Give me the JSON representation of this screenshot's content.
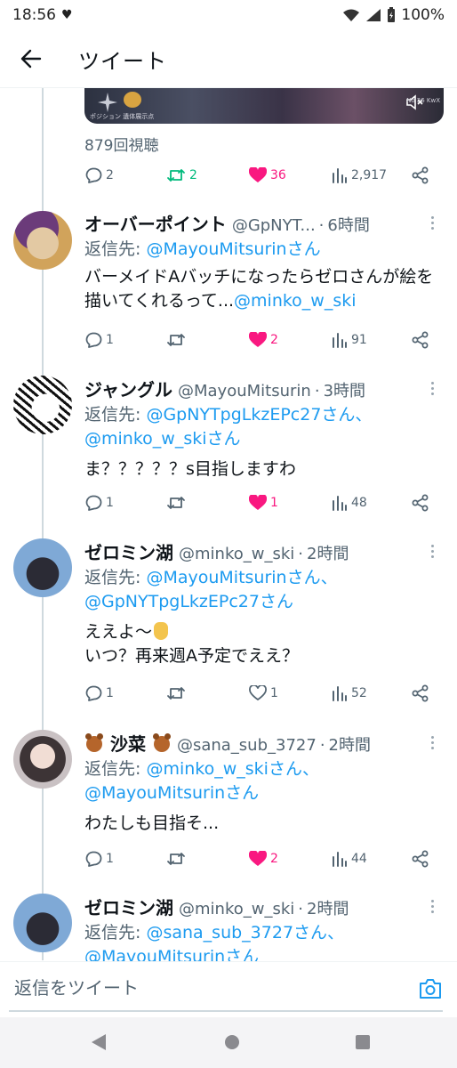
{
  "status_bar": {
    "time": "18:56",
    "battery": "100%"
  },
  "header": {
    "title": "ツイート"
  },
  "first_tweet": {
    "views": "879回視聴",
    "media_caption": "ポジション 遺体展示点",
    "media_number": "No.26 KwX",
    "actions": {
      "replies": "2",
      "retweets": "2",
      "likes": "36",
      "views": "2,917"
    }
  },
  "tweets": [
    {
      "name": "オーバーポイント",
      "handle": "@GpNYT...",
      "time": "6時間",
      "reply_prefix": "返信先: ",
      "reply_to": "@MayouMitsurinさん",
      "reply_to_2": "",
      "body": "バーメイドAバッチになったらゼロさんが絵を描いてくれるって...",
      "body_mention": "@minko_w_ski",
      "actions": {
        "replies": "1",
        "retweets": "",
        "likes": "2",
        "views": "91"
      },
      "liked": true
    },
    {
      "name": "ジャングル",
      "handle": "@MayouMitsurin",
      "time": "3時間",
      "reply_prefix": "返信先: ",
      "reply_to": "@GpNYTpgLkzEPc27さん、",
      "reply_to_2": "@minko_w_skiさん",
      "body": "ま？？？？？s目指しますわ",
      "actions": {
        "replies": "1",
        "retweets": "",
        "likes": "1",
        "views": "48"
      },
      "liked": true
    },
    {
      "name": "ゼロミン湖",
      "handle": "@minko_w_ski",
      "time": "2時間",
      "reply_prefix": "返信先: ",
      "reply_to": "@MayouMitsurinさん、",
      "reply_to_2": "@GpNYTpgLkzEPc27さん",
      "body_line1": "ええよ〜",
      "body_line2": "いつ？再来週A予定でええ？",
      "actions": {
        "replies": "1",
        "retweets": "",
        "likes": "1",
        "views": "52"
      },
      "liked": false
    },
    {
      "name": "沙菜",
      "handle": "@sana_sub_3727",
      "time": "2時間",
      "reply_prefix": "返信先: ",
      "reply_to": "@minko_w_skiさん、",
      "reply_to_2": "@MayouMitsurinさん",
      "body": "わたしも目指そ...",
      "actions": {
        "replies": "1",
        "retweets": "",
        "likes": "2",
        "views": "44"
      },
      "liked": true
    },
    {
      "name": "ゼロミン湖",
      "handle": "@minko_w_ski",
      "time": "2時間",
      "reply_prefix": "返信先: ",
      "reply_to": "@sana_sub_3727さん、",
      "reply_to_2": "@MayouMitsurinさん"
    }
  ],
  "dot_separator": "·",
  "compose": {
    "placeholder": "返信をツイート"
  },
  "colors": {
    "accent": "#1d9bf0",
    "like": "#f91880",
    "retweet": "#00ba7c",
    "muted": "#536471"
  },
  "icons": [
    "back-arrow-icon",
    "reply-icon",
    "retweet-icon",
    "heart-icon",
    "views-icon",
    "share-icon",
    "more-icon",
    "camera-icon"
  ]
}
